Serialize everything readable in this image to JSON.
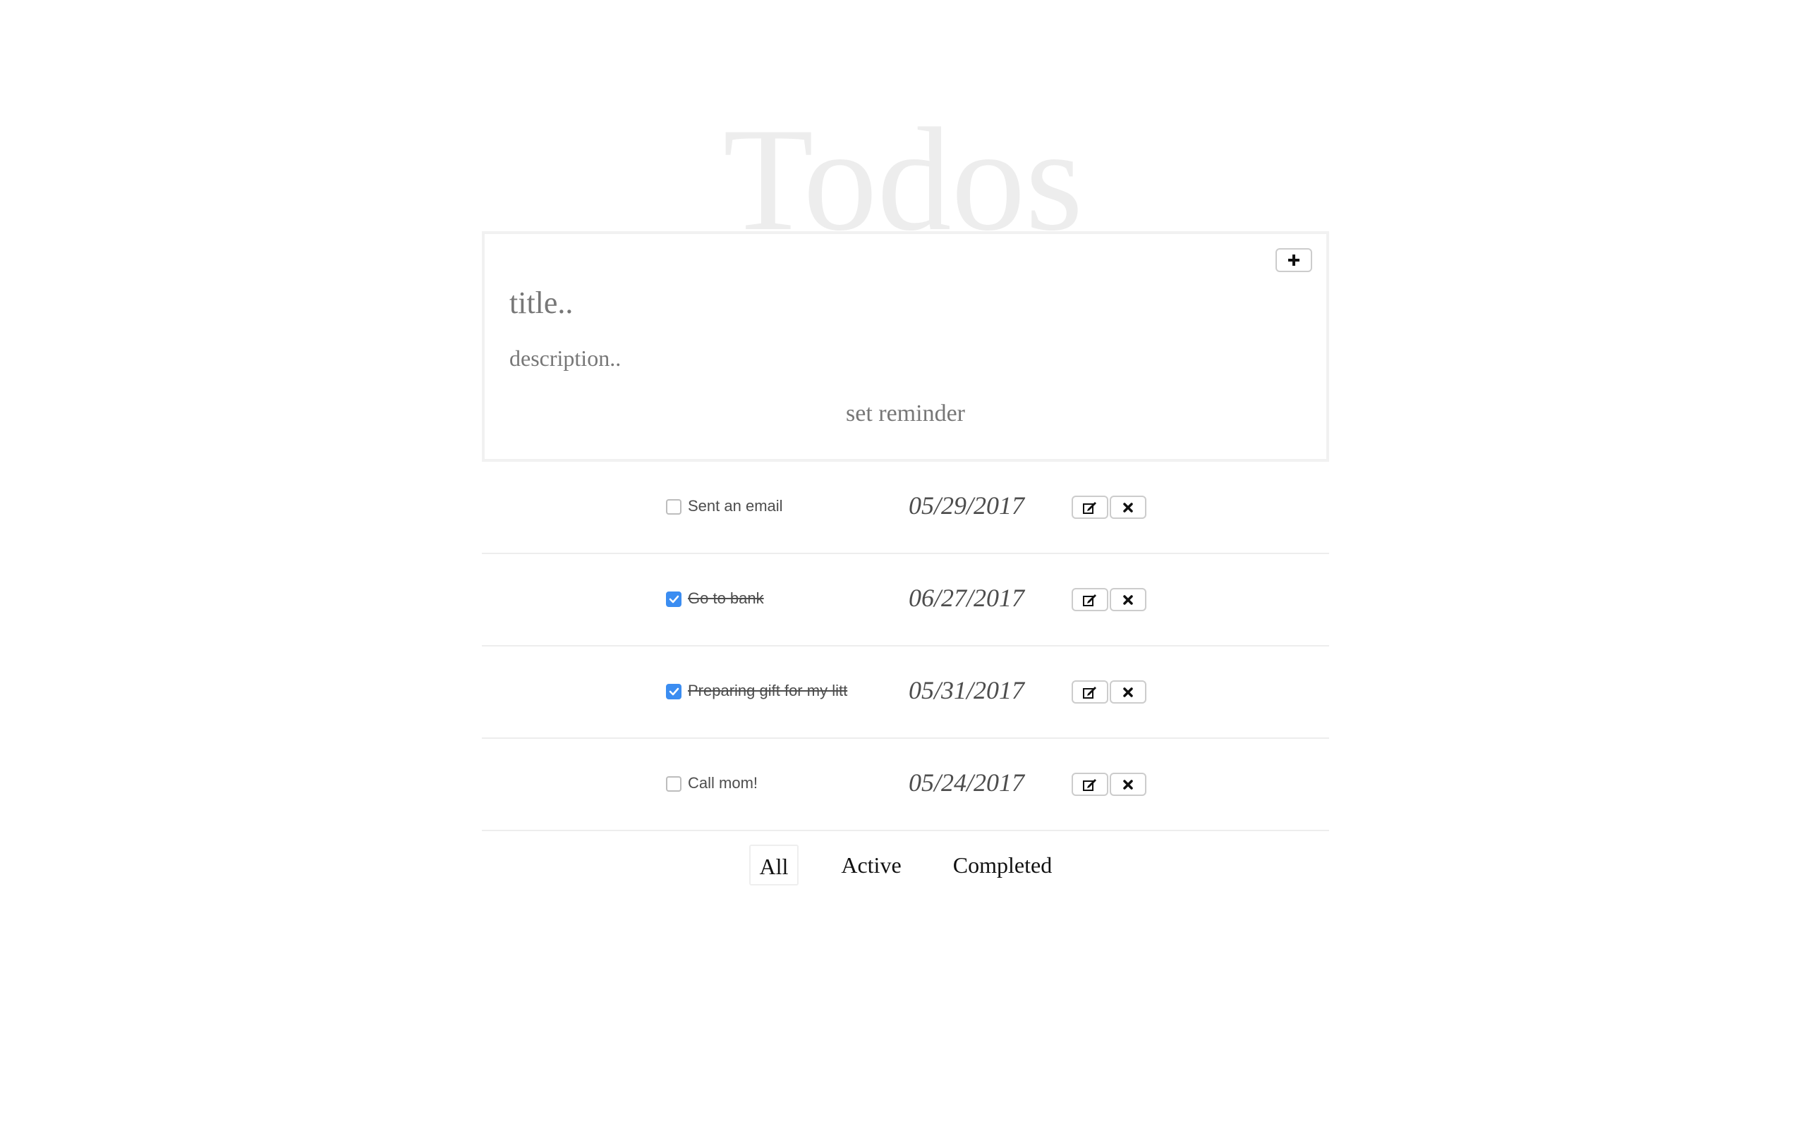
{
  "app": {
    "title": "Todos"
  },
  "new_todo": {
    "title_placeholder": "title..",
    "description_placeholder": "description..",
    "reminder_label": "set reminder",
    "add_icon": "plus-icon"
  },
  "todos": [
    {
      "text": "Sent an email",
      "date": "05/29/2017",
      "completed": false
    },
    {
      "text": "Go to bank",
      "date": "06/27/2017",
      "completed": true
    },
    {
      "text": "Preparing gift for my litt",
      "date": "05/31/2017",
      "completed": true
    },
    {
      "text": "Call mom!",
      "date": "05/24/2017",
      "completed": false
    }
  ],
  "row_icons": {
    "edit": "edit-icon",
    "delete": "close-icon"
  },
  "filters": {
    "all": "All",
    "active": "Active",
    "completed": "Completed",
    "selected": "all"
  },
  "colors": {
    "checkbox_checked": "#3b8df1",
    "title_watermark": "#ededed"
  }
}
